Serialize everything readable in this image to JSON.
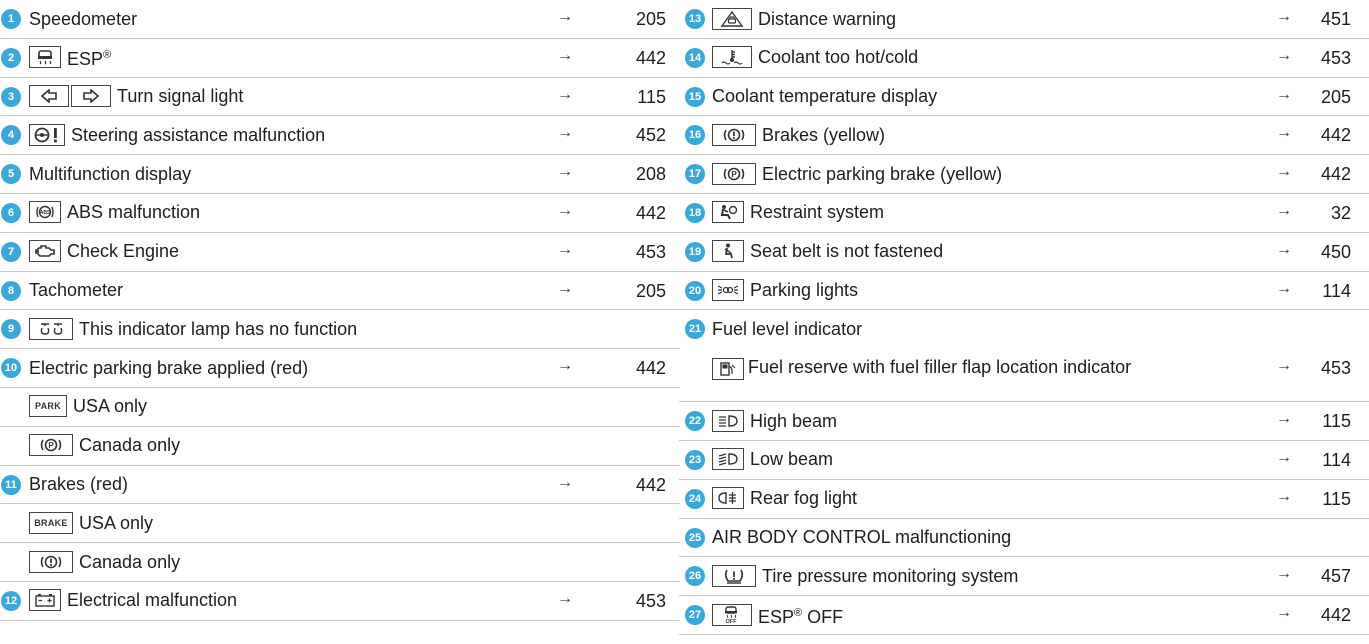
{
  "left": [
    {
      "num": "1",
      "icon": "",
      "label": "Speedometer",
      "page": "205"
    },
    {
      "num": "2",
      "icon": "esp-icon",
      "label": "ESP",
      "sup": "®",
      "page": "442"
    },
    {
      "num": "3",
      "icon": "turn-signal-icons",
      "label": "Turn signal light",
      "page": "115"
    },
    {
      "num": "4",
      "icon": "steering-malfunction-icon",
      "label": "Steering assistance malfunction",
      "page": "452"
    },
    {
      "num": "5",
      "icon": "",
      "label": "Multifunction display",
      "page": "208"
    },
    {
      "num": "6",
      "icon": "abs-icon",
      "label": "ABS malfunction",
      "page": "442"
    },
    {
      "num": "7",
      "icon": "check-engine-icon",
      "label": "Check Engine",
      "page": "453"
    },
    {
      "num": "8",
      "icon": "",
      "label": "Tachometer",
      "page": "205"
    },
    {
      "num": "9",
      "icon": "glow-plug-icon",
      "label": "This indicator lamp has no function",
      "page": ""
    },
    {
      "num": "10",
      "icon": "",
      "label": "Electric parking brake applied (red)",
      "page": "442"
    },
    {
      "num": "",
      "icon": "park-text-icon",
      "label": "USA only",
      "page": ""
    },
    {
      "num": "",
      "icon": "parking-brake-icon",
      "label": "Canada only",
      "page": ""
    },
    {
      "num": "11",
      "icon": "",
      "label": "Brakes (red)",
      "page": "442"
    },
    {
      "num": "",
      "icon": "brake-text-icon",
      "label": "USA only",
      "page": ""
    },
    {
      "num": "",
      "icon": "brake-warning-icon",
      "label": "Canada only",
      "page": ""
    },
    {
      "num": "12",
      "icon": "battery-icon",
      "label": "Electrical malfunction",
      "page": "453"
    }
  ],
  "right": [
    {
      "num": "13",
      "icon": "distance-warning-icon",
      "label": "Distance warning",
      "page": "451"
    },
    {
      "num": "14",
      "icon": "coolant-icon",
      "label": "Coolant too hot/cold",
      "page": "453"
    },
    {
      "num": "15",
      "icon": "",
      "label": "Coolant temperature display",
      "page": "205"
    },
    {
      "num": "16",
      "icon": "brake-warning-icon",
      "label": "Brakes (yellow)",
      "page": "442"
    },
    {
      "num": "17",
      "icon": "parking-brake-icon",
      "label": "Electric parking brake (yellow)",
      "page": "442"
    },
    {
      "num": "18",
      "icon": "restraint-icon",
      "label": "Restraint system",
      "page": "32"
    },
    {
      "num": "19",
      "icon": "seat-belt-icon",
      "label": "Seat belt is not fastened",
      "page": "450"
    },
    {
      "num": "20",
      "icon": "parking-lights-icon",
      "label": "Parking lights",
      "page": "114"
    },
    {
      "num": "21",
      "icon": "",
      "label": "Fuel level indicator",
      "page": ""
    },
    {
      "num": "",
      "icon": "fuel-reserve-icon",
      "label": "Fuel reserve with fuel filler flap location indicator",
      "page": "453"
    },
    {
      "num": "22",
      "icon": "high-beam-icon",
      "label": "High beam",
      "page": "115"
    },
    {
      "num": "23",
      "icon": "low-beam-icon",
      "label": "Low beam",
      "page": "114"
    },
    {
      "num": "24",
      "icon": "rear-fog-icon",
      "label": "Rear fog light",
      "page": "115"
    },
    {
      "num": "25",
      "icon": "",
      "label": "AIR BODY CONTROL malfunctioning",
      "page": ""
    },
    {
      "num": "26",
      "icon": "tire-pressure-icon",
      "label": "Tire pressure monitoring system",
      "page": "457"
    },
    {
      "num": "27",
      "icon": "esp-off-icon",
      "label": "ESP",
      "sup": "®",
      "label2": " OFF",
      "page": "442"
    }
  ],
  "icon_text": {
    "park": "PARK",
    "brake": "BRAKE"
  },
  "arrow": "→",
  "colors": {
    "badge": "#3aa8d8",
    "rule": "#c9c9c9",
    "text": "#1e1e1e"
  }
}
